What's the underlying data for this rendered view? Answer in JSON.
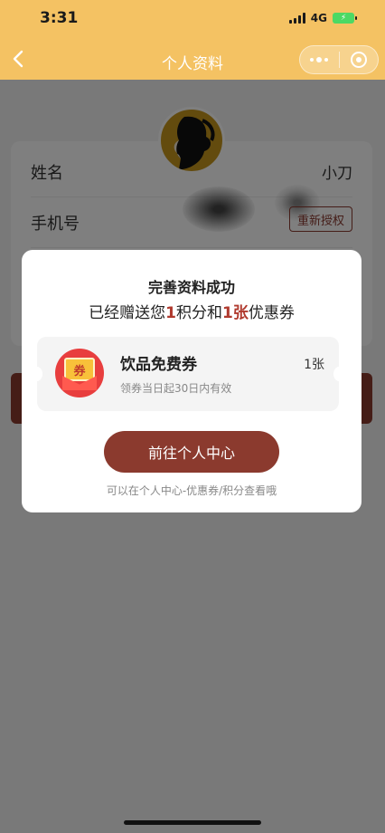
{
  "status_bar": {
    "time": "3:31",
    "network": "4G"
  },
  "nav": {
    "title": "个人资料"
  },
  "profile": {
    "rows": [
      {
        "label": "姓名",
        "value": "小刀"
      },
      {
        "label": "手机号",
        "value": ""
      }
    ],
    "reauth_label": "重新授权"
  },
  "modal": {
    "title": "完善资料成功",
    "desc_prefix": "已经赠送您",
    "points": "1",
    "points_unit": "积分和",
    "coupons": "1张",
    "coupons_unit": "优惠券",
    "coupon": {
      "icon_text": "券",
      "name": "饮品免费券",
      "validity": "领券当日起30日内有效",
      "count": "1张"
    },
    "button_label": "前往个人中心",
    "hint": "可以在个人中心-优惠券/积分查看哦"
  },
  "colors": {
    "header": "#f4c263",
    "accent": "#8b3a2e",
    "highlight": "#b03a2e"
  }
}
